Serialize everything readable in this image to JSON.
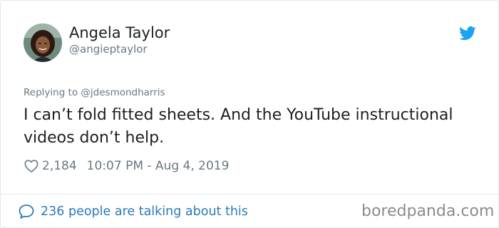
{
  "author": {
    "name": "Angela Taylor",
    "handle": "@angieptaylor"
  },
  "reply": {
    "prefix": "Replying to",
    "to": "@jdesmondharris"
  },
  "tweet": {
    "text": "I can’t fold fitted sheets. And the YouTube instructional videos don’t help."
  },
  "meta": {
    "likes": "2,184",
    "timestamp": "10:07 PM - Aug 4, 2019"
  },
  "footer": {
    "talking": "236 people are talking about this"
  },
  "watermark": "boredpanda.com",
  "colors": {
    "accent": "#1da1f2",
    "link": "#2b7bb9",
    "muted": "#697882",
    "border": "#e1e8ed"
  },
  "icons": {
    "platform": "twitter-bird-icon",
    "like": "heart-outline-icon",
    "conversation": "speech-bubble-icon"
  }
}
